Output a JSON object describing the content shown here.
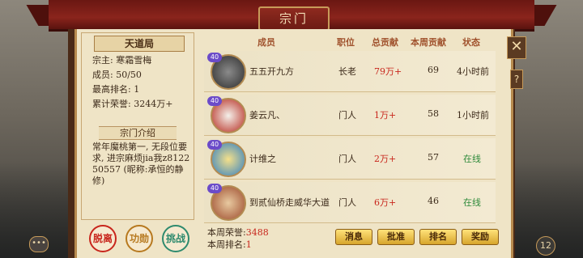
{
  "window": {
    "title": "宗门"
  },
  "sect": {
    "name": "天道局",
    "leader": "宗主: 寒霜雪梅",
    "members": "成员: 50/50",
    "best_rank": "最高排名: 1",
    "honor": "累计荣誉: 3244万+",
    "intro_label": "宗门介绍",
    "intro_text": "常年魔桃第一, 无段位要求, 进宗麻烦jia我z812250557 (昵称:承恒的静修)"
  },
  "side_buttons": [
    {
      "label": "脱离",
      "icon": "leave-seal",
      "color": "#c8261c"
    },
    {
      "label": "功勋",
      "icon": "merit-seal",
      "color": "#b7791f"
    },
    {
      "label": "挑战",
      "icon": "challenge-seal",
      "color": "#2e8a6e"
    }
  ],
  "table": {
    "headers": [
      "成员",
      "职位",
      "总贡献",
      "本周贡献",
      "状态"
    ],
    "rows": [
      {
        "name": "五五开九方",
        "level": "40",
        "role": "长老",
        "total": "79万+",
        "week": "69",
        "status": "4小时前",
        "online": false
      },
      {
        "name": "姜云凡、",
        "level": "40",
        "role": "门人",
        "total": "1万+",
        "week": "58",
        "status": "1小时前",
        "online": false
      },
      {
        "name": "计维之",
        "level": "40",
        "role": "门人",
        "total": "2万+",
        "week": "57",
        "status": "在线",
        "online": true
      },
      {
        "name": "到贰仙桥走威华大道",
        "level": "40",
        "role": "门人",
        "total": "6万+",
        "week": "46",
        "status": "在线",
        "online": true
      }
    ]
  },
  "footer": {
    "week_honor_label": "本周荣誉:",
    "week_honor_value": "3488",
    "week_rank_label": "本周排名:",
    "week_rank_value": "1",
    "buttons": [
      "消息",
      "批准",
      "排名",
      "奖励"
    ]
  },
  "controls": {
    "close": "✕",
    "help": "?",
    "chat": "•••",
    "count": "12"
  },
  "colors": {
    "accent_red": "#c8261c",
    "online_green": "#2e8a3a",
    "roof": "#8a241c",
    "panel": "#efe4c6"
  }
}
